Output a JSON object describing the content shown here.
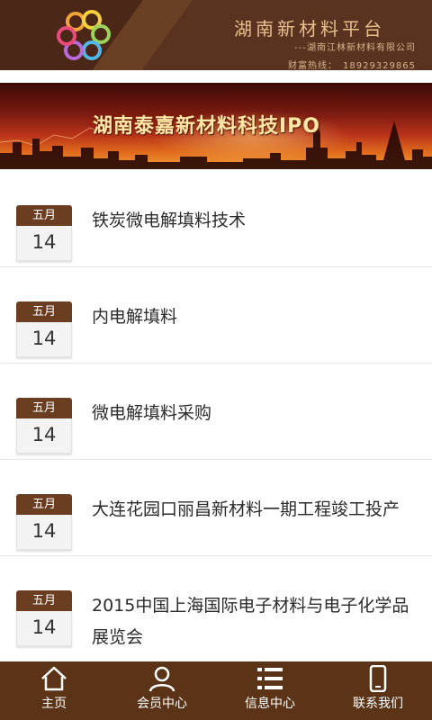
{
  "header": {
    "brand_title": "湖南新材料平台",
    "brand_subtitle": "---湖南江林新材料有限公司",
    "hotline_label": "财富热线：",
    "hotline_number": "18929329865"
  },
  "banner": {
    "title": "湖南泰嘉新材料科技IPO"
  },
  "news": [
    {
      "month": "五月",
      "day": "14",
      "title": "铁炭微电解填料技术"
    },
    {
      "month": "五月",
      "day": "14",
      "title": "内电解填料"
    },
    {
      "month": "五月",
      "day": "14",
      "title": "微电解填料采购"
    },
    {
      "month": "五月",
      "day": "14",
      "title": "大连花园口丽昌新材料一期工程竣工投产"
    },
    {
      "month": "五月",
      "day": "14",
      "title": "2015中国上海国际电子材料与电子化学品展览会"
    }
  ],
  "nav": [
    {
      "label": "主页",
      "icon": "home-icon"
    },
    {
      "label": "会员中心",
      "icon": "user-icon"
    },
    {
      "label": "信息中心",
      "icon": "list-icon"
    },
    {
      "label": "联系我们",
      "icon": "phone-icon"
    }
  ],
  "colors": {
    "header_bg": "#4a2716",
    "accent": "#6b3e22",
    "nav_bg": "#5b3417",
    "gold_text": "#e7c08e"
  }
}
